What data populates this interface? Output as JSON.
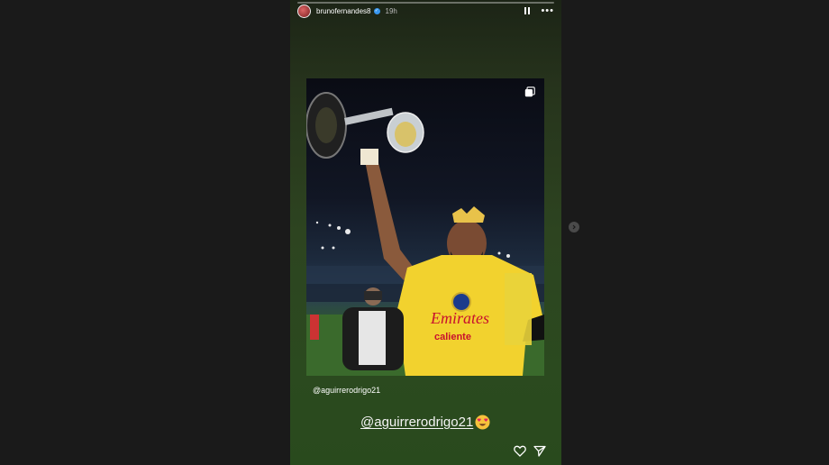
{
  "story": {
    "progress_fraction": 0.0,
    "username": "brunofernandes8",
    "time": "19h",
    "caption_tag": "@aguirrerodrigo21",
    "mention_sticker": "@aguirrerodrigo21"
  },
  "photo": {
    "jersey_text_1": "Emirates",
    "jersey_text_2": "caliente"
  },
  "icons": [
    "verified-badge-icon",
    "pause-icon",
    "more-options-icon",
    "multi-photo-icon",
    "heart-eyes-emoji",
    "heart-icon",
    "send-icon",
    "next-arrow-icon"
  ],
  "colors": {
    "story_bg": "#2d4420",
    "jersey": "#f2d22e",
    "verified": "#3897f0"
  }
}
